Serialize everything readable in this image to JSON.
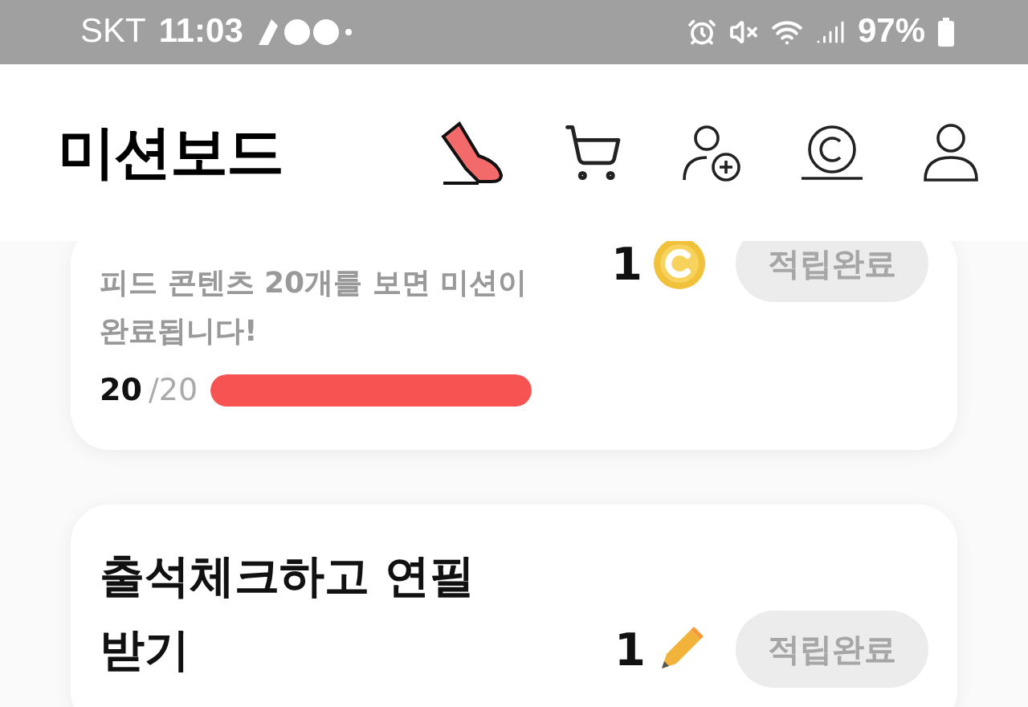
{
  "status_bar": {
    "carrier": "SKT",
    "time": "11:03",
    "battery": "97%"
  },
  "header": {
    "title": "미션보드"
  },
  "missions": [
    {
      "kind": "coin",
      "reward_count": "1",
      "button": "적립완료",
      "claimed": true,
      "description": "피드 콘텐츠 20개를 보면 미션이 완료됩니다!",
      "progress_done": "20",
      "progress_total": "/20",
      "level": 1
    },
    {
      "kind": "pencil",
      "reward_count": "1",
      "button": "적립완료",
      "claimed": true,
      "title": "출석체크하고 연필 받기"
    }
  ]
}
